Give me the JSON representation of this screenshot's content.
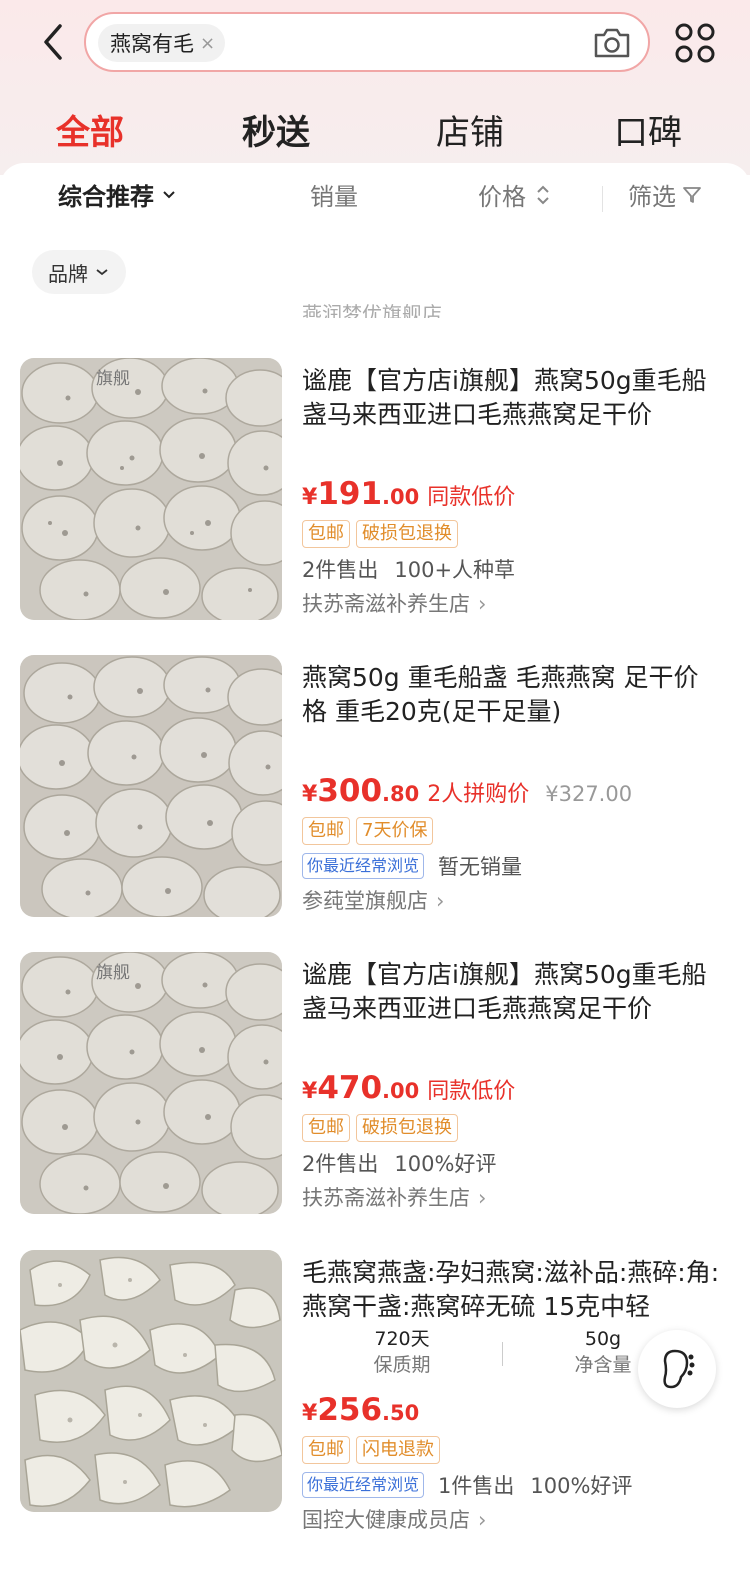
{
  "search": {
    "query": "燕窝有毛",
    "clear_icon": "×"
  },
  "tabs": [
    "全部",
    "秒送",
    "店铺",
    "口碑"
  ],
  "sort": {
    "recommend": "综合推荐",
    "sales": "销量",
    "price": "价格",
    "filter": "筛选"
  },
  "brand_chip": "品牌",
  "clipped_store": "燕润梦优旗舰店",
  "products": [
    {
      "title": "谧鹿【官方店i旗舰】燕窝50g重毛船盏马来西亚进口毛燕燕窝足干价",
      "image_watermark": "旗舰",
      "price_int": "191",
      "price_dec": ".00",
      "price_label": "同款低价",
      "tags": [
        "包邮",
        "破损包退换"
      ],
      "sold": "2件售出",
      "extra": "100+人种草",
      "shop": "扶苏斋滋补养生店"
    },
    {
      "title": "燕窝50g 重毛船盏 毛燕燕窝 足干价格 重毛20克(足干足量)",
      "price_int": "300",
      "price_dec": ".80",
      "price_label": "2人拼购价",
      "orig_price": "¥327.00",
      "tags": [
        "包邮",
        "7天价保"
      ],
      "badge": "你最近经常浏览",
      "extra": "暂无销量",
      "shop": "参莼堂旗舰店"
    },
    {
      "title": "谧鹿【官方店i旗舰】燕窝50g重毛船盏马来西亚进口毛燕燕窝足干价",
      "image_watermark": "旗舰",
      "price_int": "470",
      "price_dec": ".00",
      "price_label": "同款低价",
      "tags": [
        "包邮",
        "破损包退换"
      ],
      "sold": "2件售出",
      "extra": "100%好评",
      "shop": "扶苏斋滋补养生店"
    },
    {
      "title": "毛燕窝燕盏:孕妇燕窝:滋补品:燕碎:角:燕窝干盏:燕窝碎无硫 15克中轻",
      "specs": [
        {
          "value": "720天",
          "label": "保质期"
        },
        {
          "value": "50g",
          "label": "净含量"
        }
      ],
      "price_int": "256",
      "price_dec": ".50",
      "tags": [
        "包邮",
        "闪电退款"
      ],
      "badge": "你最近经常浏览",
      "sold": "1件售出",
      "extra": "100%好评",
      "shop": "国控大健康成员店"
    }
  ],
  "currency": "¥",
  "icons": {
    "back": "back-arrow-icon",
    "camera": "camera-icon",
    "more": "grid-menu-icon",
    "footprint": "footprint-icon"
  },
  "colors": {
    "accent": "#e8312a",
    "tag": "#e18d2b",
    "badge": "#3a6fd8"
  }
}
